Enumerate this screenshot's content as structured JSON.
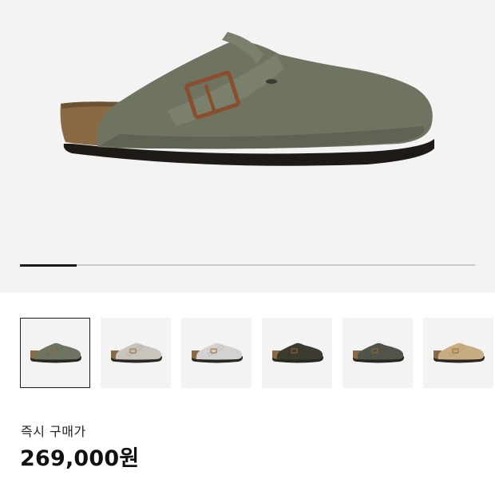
{
  "product": {
    "image_name": "boston-clog-thyme-suede",
    "gallery_progress": 0.125
  },
  "thumbnails": [
    {
      "name": "thumb-thyme",
      "color": "#6f7461",
      "selected": true
    },
    {
      "name": "thumb-stone",
      "color": "#c9c5be",
      "selected": false
    },
    {
      "name": "thumb-gray",
      "color": "#d3d2d0",
      "selected": false
    },
    {
      "name": "thumb-olive-dark",
      "color": "#3b3b30",
      "selected": false
    },
    {
      "name": "thumb-moss",
      "color": "#51544a",
      "selected": false
    },
    {
      "name": "thumb-sand",
      "color": "#c8ad82",
      "selected": false
    }
  ],
  "purchase": {
    "label": "즉시 구매가",
    "price": "269,000원"
  }
}
